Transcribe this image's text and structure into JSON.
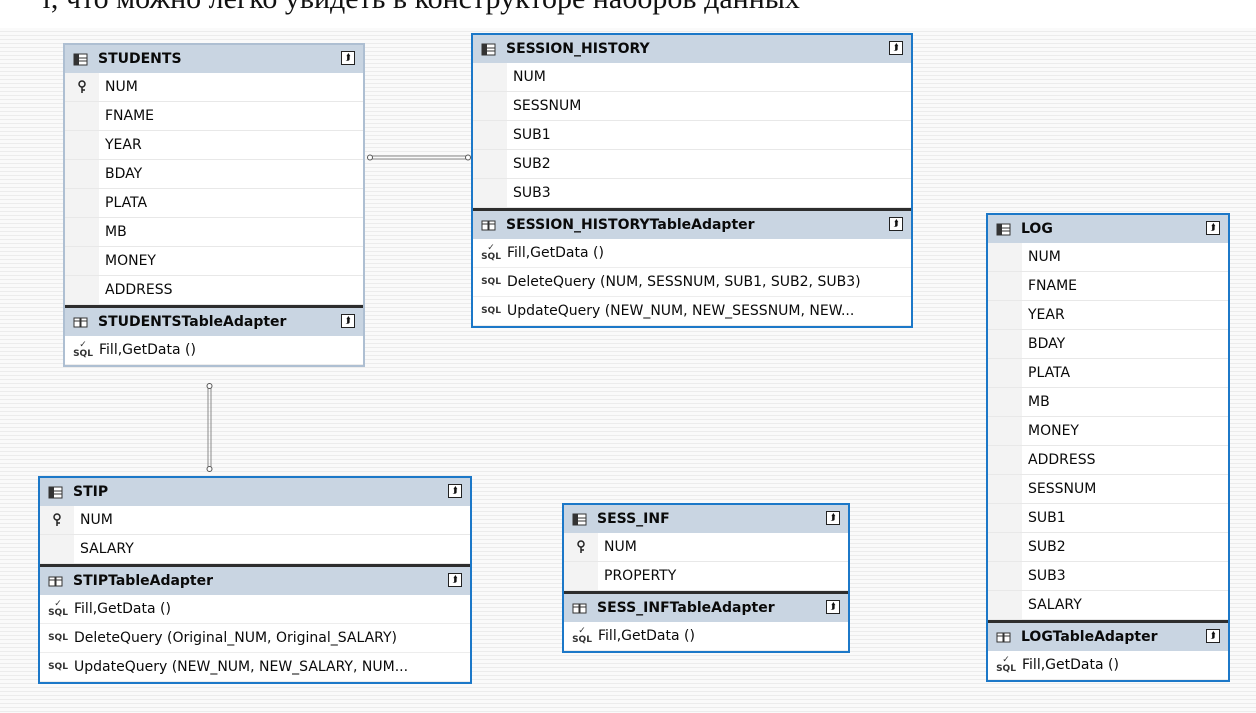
{
  "caption": "т, что можно легко увидеть в конструкторе наборов данных",
  "icons": {
    "table": "table-icon",
    "adapter": "table-adapter-icon",
    "key": "key-icon",
    "query": "sql-query-icon",
    "collapse": "collapse-icon"
  },
  "colors": {
    "selected_border": "#1c78c8",
    "header": "#c9d5e2"
  },
  "students": {
    "title": "STUDENTS",
    "columns": [
      "NUM",
      "FNAME",
      "YEAR",
      "BDAY",
      "PLATA",
      "MB",
      "MONEY",
      "ADDRESS"
    ],
    "adapter": "STUDENTSTableAdapter",
    "queries": [
      "Fill,GetData ()"
    ]
  },
  "session_history": {
    "title": "SESSION_HISTORY",
    "columns": [
      "NUM",
      "SESSNUM",
      "SUB1",
      "SUB2",
      "SUB3"
    ],
    "adapter": "SESSION_HISTORYTableAdapter",
    "queries": [
      "Fill,GetData ()",
      "DeleteQuery (NUM, SESSNUM, SUB1, SUB2, SUB3)",
      "UpdateQuery (NEW_NUM, NEW_SESSNUM, NEW..."
    ]
  },
  "log": {
    "title": "LOG",
    "columns": [
      "NUM",
      "FNAME",
      "YEAR",
      "BDAY",
      "PLATA",
      "MB",
      "MONEY",
      "ADDRESS",
      "SESSNUM",
      "SUB1",
      "SUB2",
      "SUB3",
      "SALARY"
    ],
    "adapter": "LOGTableAdapter",
    "queries": [
      "Fill,GetData ()"
    ]
  },
  "stip": {
    "title": "STIP",
    "columns": [
      "NUM",
      "SALARY"
    ],
    "adapter": "STIPTableAdapter",
    "queries": [
      "Fill,GetData ()",
      "DeleteQuery (Original_NUM, Original_SALARY)",
      "UpdateQuery (NEW_NUM, NEW_SALARY, NUM..."
    ]
  },
  "sess_inf": {
    "title": "SESS_INF",
    "columns": [
      "NUM",
      "PROPERTY"
    ],
    "adapter": "SESS_INFTableAdapter",
    "queries": [
      "Fill,GetData ()"
    ]
  },
  "sql_label": "SQL"
}
